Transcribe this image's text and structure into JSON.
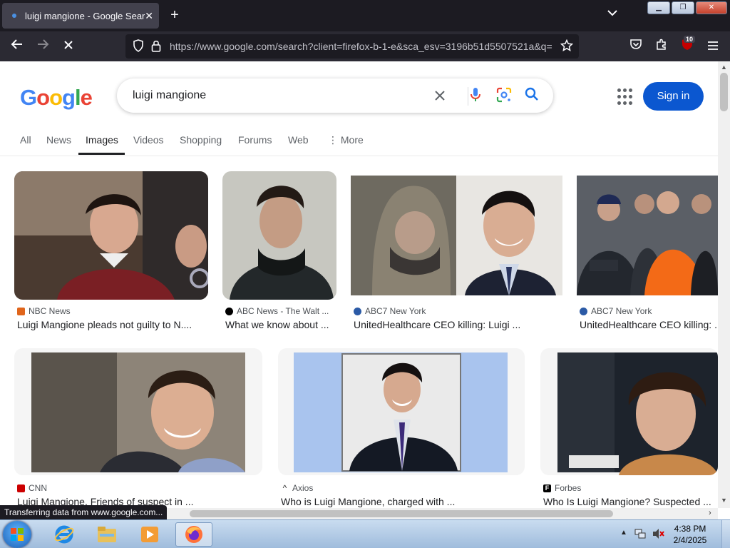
{
  "browser": {
    "tab_title": "luigi mangione - Google Search",
    "tab_close": "✕",
    "new_tab": "+",
    "tab_list": "⌄",
    "url": "https://www.google.com/search?client=firefox-b-1-e&sca_esv=3196b51d5507521a&q=",
    "extension_badge": "10",
    "status": "Transferring data from www.google.com..."
  },
  "google": {
    "logo": [
      "G",
      "o",
      "o",
      "g",
      "l",
      "e"
    ],
    "query": "luigi mangione",
    "sign_in": "Sign in",
    "tabs": [
      "All",
      "News",
      "Images",
      "Videos",
      "Shopping",
      "Forums",
      "Web",
      "More"
    ],
    "active_tab": "Images"
  },
  "results": [
    {
      "source": "NBC News",
      "caption": "Luigi Mangione pleads not guilty to N....",
      "favicon_color": "#e0651b",
      "tone": "#6b3a2a"
    },
    {
      "source": "ABC News - The Walt ...",
      "caption": "What we know about ...",
      "favicon_color": "#000000",
      "tone": "#2c3130"
    },
    {
      "source": "ABC7 New York",
      "caption": "UnitedHealthcare CEO killing: Luigi ...",
      "favicon_color": "#2b5aa6",
      "tone": "#6d6860"
    },
    {
      "source": "ABC7 New York",
      "caption": "UnitedHealthcare CEO killing: ...",
      "favicon_color": "#2b5aa6",
      "tone": "#e3601c"
    },
    {
      "source": "CNN",
      "caption": "Luigi Mangione, Friends of suspect in ...",
      "favicon_color": "#cc0000",
      "tone": "#8a7a6a"
    },
    {
      "source": "Axios",
      "caption": "Who is Luigi Mangione, charged with ...",
      "favicon_color": "#333333",
      "tone": "#a9c4ee"
    },
    {
      "source": "Forbes",
      "caption": "Who Is Luigi Mangione? Suspected ...",
      "favicon_color": "#000000",
      "tone": "#1d232c"
    }
  ],
  "taskbar": {
    "time": "4:38 PM",
    "date": "2/4/2025"
  },
  "colors": {
    "accent": "#0b57d0",
    "tab_bg": "#42414d",
    "toolbar_bg": "#2b2a33"
  }
}
